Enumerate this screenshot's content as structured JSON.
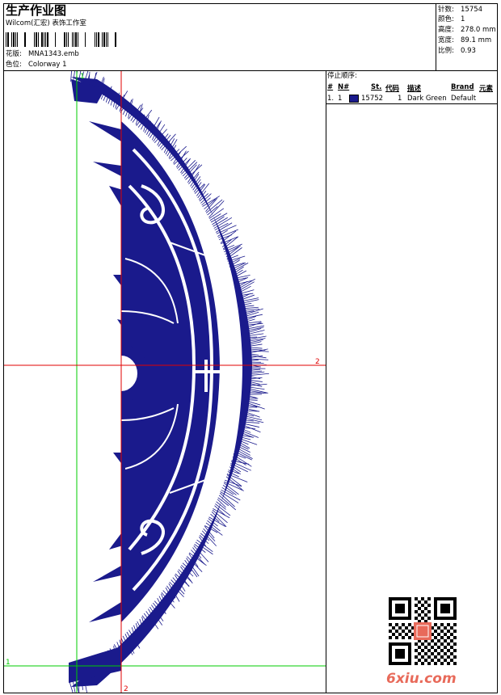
{
  "header": {
    "title": "生产作业图",
    "company": "Wilcom(汇宏) 表饰工作室",
    "design_label": "花版:",
    "design_value": "MNA1343.emb",
    "colorway_label": "色位:",
    "colorway_value": "Colorway 1"
  },
  "stats": {
    "stitches": {
      "label": "针数:",
      "value": "15754"
    },
    "colors": {
      "label": "颜色:",
      "value": "1"
    },
    "height": {
      "label": "高度:",
      "value": "278.0 mm"
    },
    "width": {
      "label": "宽度:",
      "value": "89.1 mm"
    },
    "scale": {
      "label": "比例:",
      "value": "0.93"
    }
  },
  "stop_sequence": {
    "title": "停止顺序:",
    "columns": {
      "num": "#",
      "needle": "N#",
      "st": "St.",
      "code": "代码",
      "desc": "描述",
      "brand": "Brand",
      "elem": "元素"
    },
    "rows": [
      {
        "num": "1.",
        "needle": "1",
        "color": "#1a1a8c",
        "st": "15752",
        "code": "1",
        "desc": "Dark Green",
        "brand": "Default"
      }
    ]
  },
  "guides": {
    "label_v1": "1",
    "label_h1": "1",
    "label_v2": "2",
    "label_h2": "2"
  },
  "watermark": "6xiu.com",
  "colors": {
    "thread": "#1a1a8c",
    "guide_green": "#00cc00",
    "guide_red": "#e00000",
    "watermark": "#e86a5a"
  }
}
